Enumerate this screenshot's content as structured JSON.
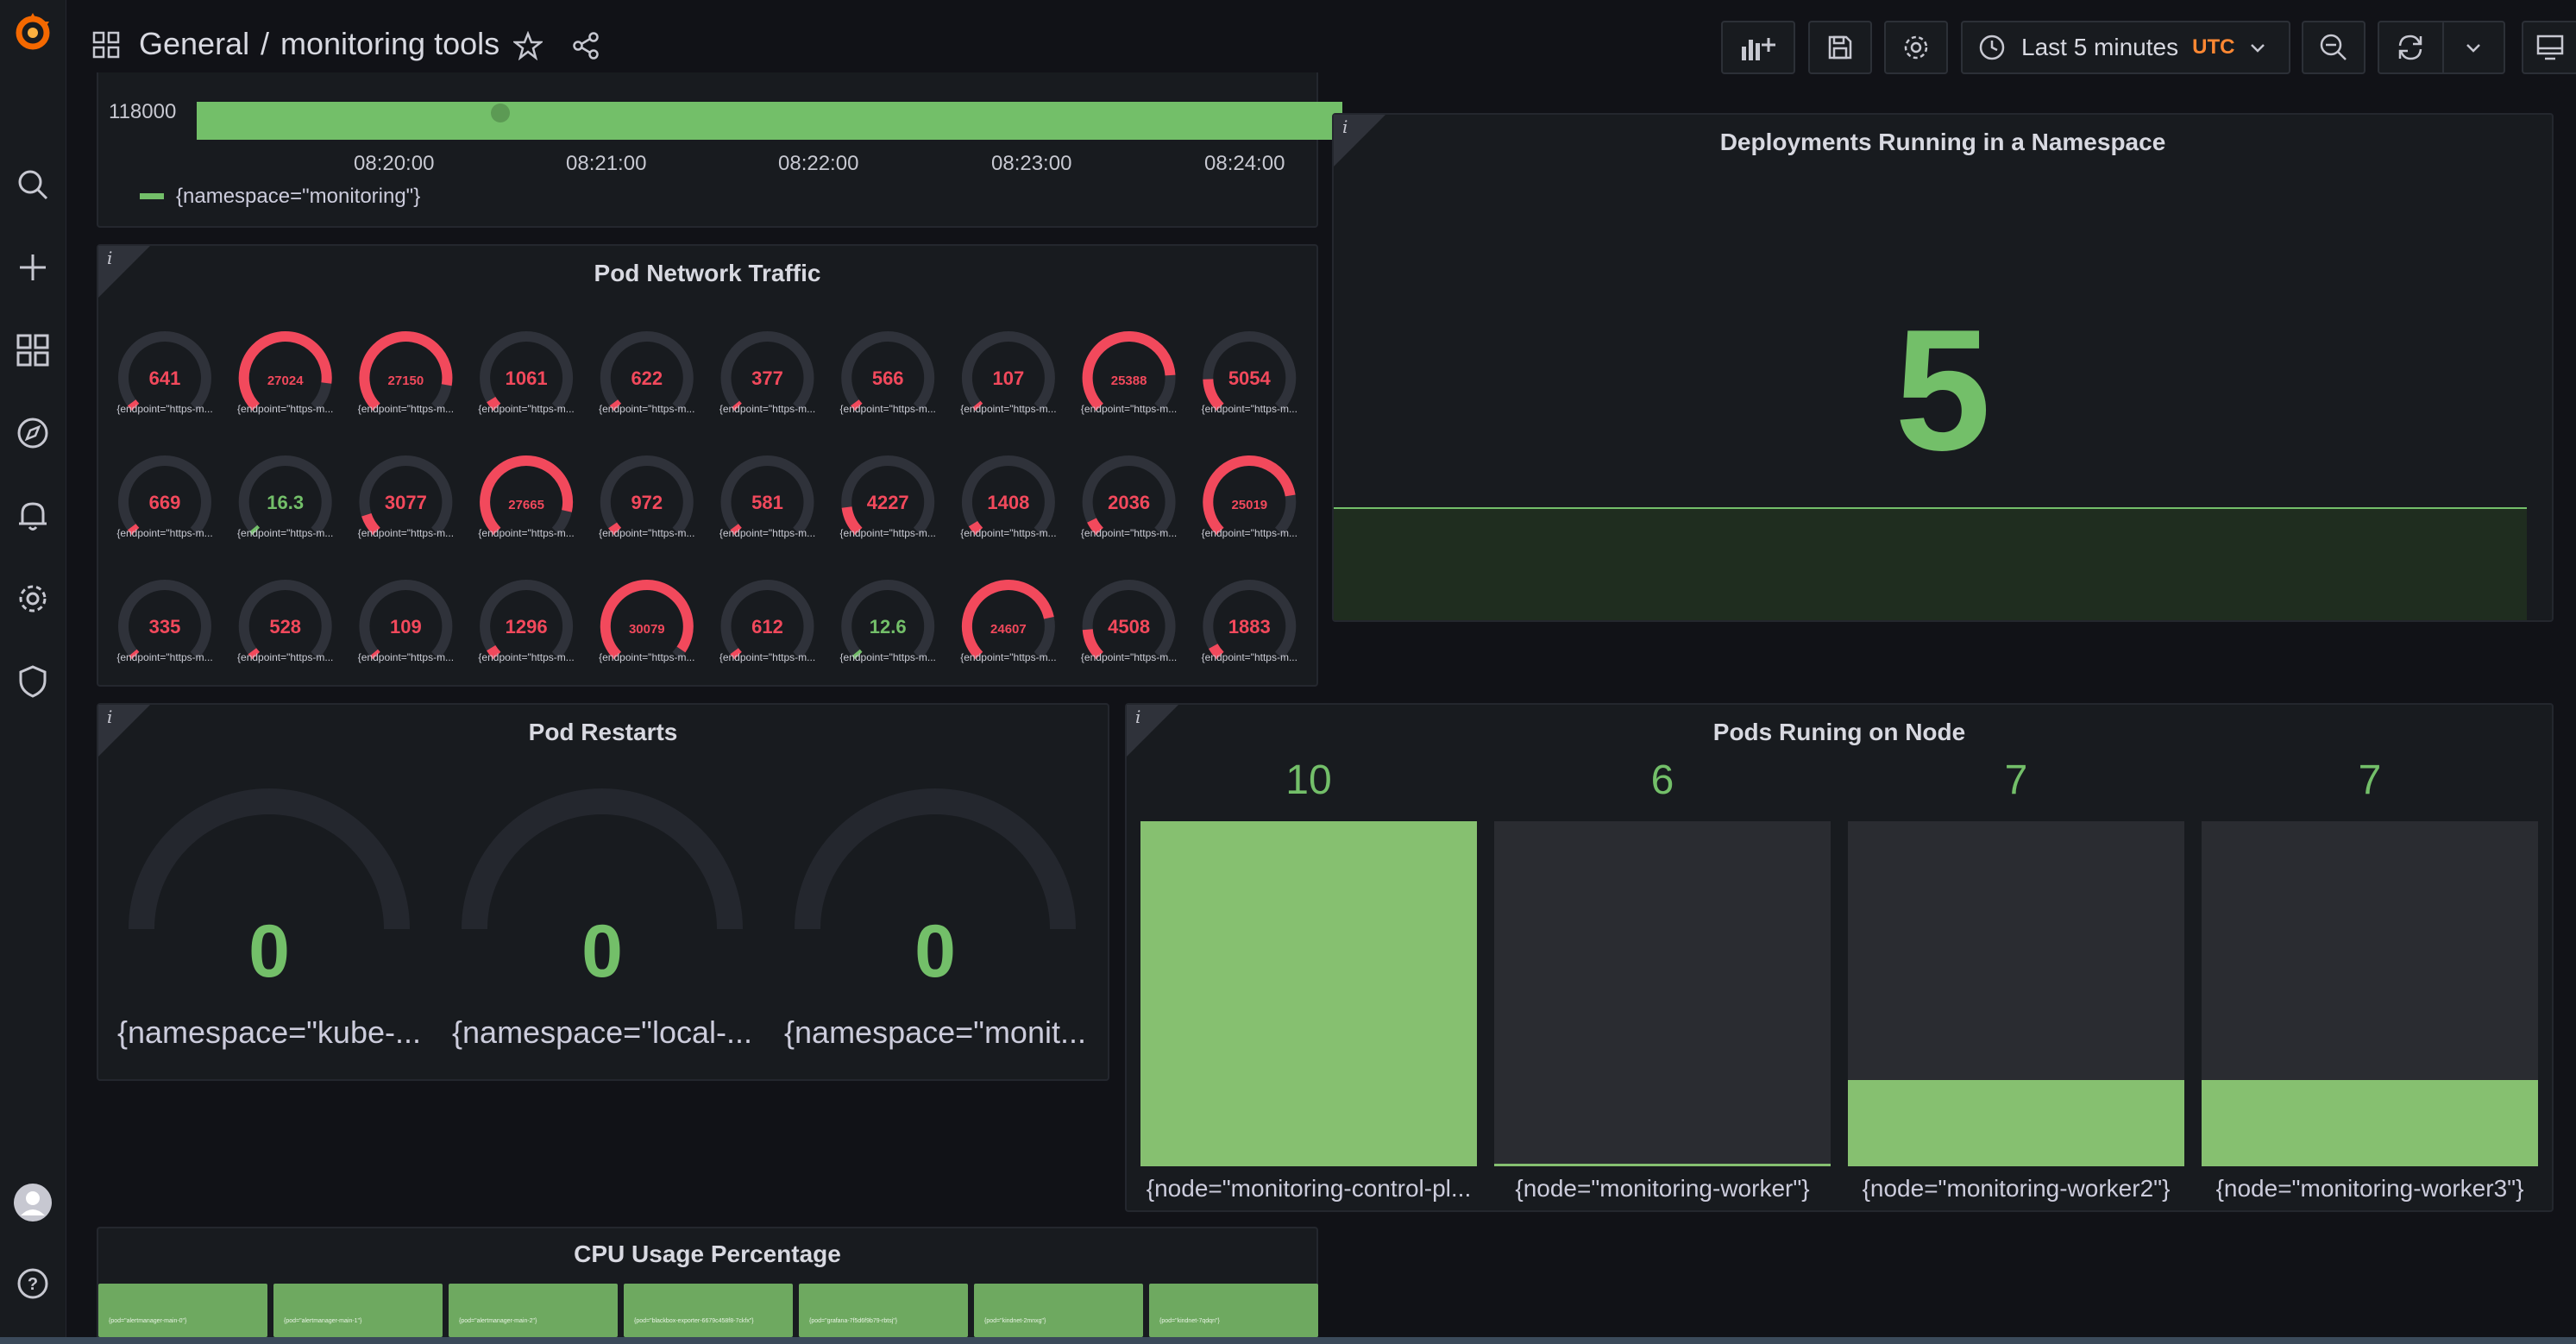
{
  "breadcrumb": {
    "folder": "General",
    "separator": "/",
    "dashboard": "monitoring tools"
  },
  "toolbar": {
    "time_range": "Last 5 minutes",
    "timezone": "UTC"
  },
  "icons": {
    "logo": "grafana-logo-icon",
    "search": "search-icon",
    "create": "plus-icon",
    "dashboards": "dashboards-grid-icon",
    "explore": "compass-icon",
    "alerting": "bell-icon",
    "configuration": "gear-icon",
    "server_admin": "shield-icon",
    "profile": "avatar-icon",
    "help": "help-icon"
  },
  "colors": {
    "green": "#73bf69",
    "red": "#f2495c",
    "background": "#111217",
    "panel": "#181b1f"
  },
  "top_panel": {
    "y_tick": "118000",
    "x_ticks": [
      "08:20:00",
      "08:21:00",
      "08:22:00",
      "08:23:00",
      "08:24:00"
    ],
    "legend": "{namespace=\"monitoring\"}"
  },
  "pod_network_traffic": {
    "title": "Pod Network Traffic",
    "label": "{endpoint=\"https-m...",
    "gauges": [
      {
        "v": "641",
        "p": 0.03,
        "c": "red"
      },
      {
        "v": "27024",
        "p": 0.86,
        "c": "red"
      },
      {
        "v": "27150",
        "p": 0.87,
        "c": "red"
      },
      {
        "v": "1061",
        "p": 0.05,
        "c": "red"
      },
      {
        "v": "622",
        "p": 0.03,
        "c": "red"
      },
      {
        "v": "377",
        "p": 0.02,
        "c": "red"
      },
      {
        "v": "566",
        "p": 0.03,
        "c": "red"
      },
      {
        "v": "107",
        "p": 0.01,
        "c": "red"
      },
      {
        "v": "25388",
        "p": 0.82,
        "c": "red"
      },
      {
        "v": "5054",
        "p": 0.16,
        "c": "red"
      },
      {
        "v": "669",
        "p": 0.03,
        "c": "red"
      },
      {
        "v": "16.3",
        "p": 0.02,
        "c": "green"
      },
      {
        "v": "3077",
        "p": 0.1,
        "c": "red"
      },
      {
        "v": "27665",
        "p": 0.88,
        "c": "red"
      },
      {
        "v": "972",
        "p": 0.04,
        "c": "red"
      },
      {
        "v": "581",
        "p": 0.03,
        "c": "red"
      },
      {
        "v": "4227",
        "p": 0.14,
        "c": "red"
      },
      {
        "v": "1408",
        "p": 0.05,
        "c": "red"
      },
      {
        "v": "2036",
        "p": 0.07,
        "c": "red"
      },
      {
        "v": "25019",
        "p": 0.8,
        "c": "red"
      },
      {
        "v": "335",
        "p": 0.02,
        "c": "red"
      },
      {
        "v": "528",
        "p": 0.03,
        "c": "red"
      },
      {
        "v": "109",
        "p": 0.01,
        "c": "red"
      },
      {
        "v": "1296",
        "p": 0.05,
        "c": "red"
      },
      {
        "v": "30079",
        "p": 0.96,
        "c": "red"
      },
      {
        "v": "612",
        "p": 0.03,
        "c": "red"
      },
      {
        "v": "12.6",
        "p": 0.02,
        "c": "green"
      },
      {
        "v": "24607",
        "p": 0.79,
        "c": "red"
      },
      {
        "v": "4508",
        "p": 0.15,
        "c": "red"
      },
      {
        "v": "1883",
        "p": 0.06,
        "c": "red"
      }
    ]
  },
  "deployments": {
    "title": "Deployments Running in a Namespace",
    "value": "5"
  },
  "pod_restarts": {
    "title": "Pod Restarts",
    "items": [
      {
        "value": "0",
        "label": "{namespace=\"kube-..."
      },
      {
        "value": "0",
        "label": "{namespace=\"local-..."
      },
      {
        "value": "0",
        "label": "{namespace=\"monit..."
      }
    ]
  },
  "pods_on_node": {
    "title": "Pods Runing on Node",
    "bars": [
      {
        "value": "10",
        "fill": 1.0,
        "label": "{node=\"monitoring-control-pl..."
      },
      {
        "value": "6",
        "fill": 0.0,
        "label": "{node=\"monitoring-worker\"}"
      },
      {
        "value": "7",
        "fill": 0.25,
        "label": "{node=\"monitoring-worker2\"}"
      },
      {
        "value": "7",
        "fill": 0.25,
        "label": "{node=\"monitoring-worker3\"}"
      }
    ]
  },
  "cpu_usage": {
    "title": "CPU Usage Percentage",
    "tiles": [
      "{pod=\"alertmanager-main-0\"}",
      "{pod=\"alertmanager-main-1\"}",
      "{pod=\"alertmanager-main-2\"}",
      "{pod=\"blackbox-exporter-6679c458f8-7ckfx\"}",
      "{pod=\"grafana-7f5d6f9b79-rbtsj\"}",
      "{pod=\"kindnet-2mnxg\"}",
      "{pod=\"kindnet-7qdqn\"}"
    ]
  }
}
